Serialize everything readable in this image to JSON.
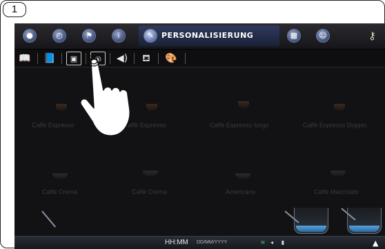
{
  "step": {
    "number": "1"
  },
  "topbar": {
    "icons": [
      "water-drop-icon",
      "clock-icon",
      "flag-icon",
      "info-icon"
    ],
    "active_tab": {
      "label": "PERSONALISIERUNG",
      "icon": "pencil-icon"
    },
    "after_icons": [
      "calculator-icon",
      "user-icon"
    ],
    "right_icon": "key-icon"
  },
  "subbar": {
    "icons": [
      "book-icon",
      "book-user-icon",
      "screen-touch-icon",
      "framed-circle-icon",
      "speaker-icon",
      "bottle-cup-icon",
      "palette-icon"
    ]
  },
  "tiles_row1": [
    "Caffè Espresso",
    "Caffè Espresso",
    "Caffè Espresso lungo",
    "Caffè Espresso Doppio"
  ],
  "tiles_row2": [
    "Caffè Crema",
    "Caffè Crema",
    "Americano",
    "Caffè Macchiato"
  ],
  "status": {
    "time": "HH:MM",
    "date": "DD/MM/YYYY",
    "icons": [
      "wifi-icon",
      "volume-icon",
      "card-icon",
      "arrow-up-icon"
    ]
  },
  "colors": {
    "accent": "#2f3a5c",
    "screen_bg": "#121214",
    "water": "#5aa3d8"
  }
}
